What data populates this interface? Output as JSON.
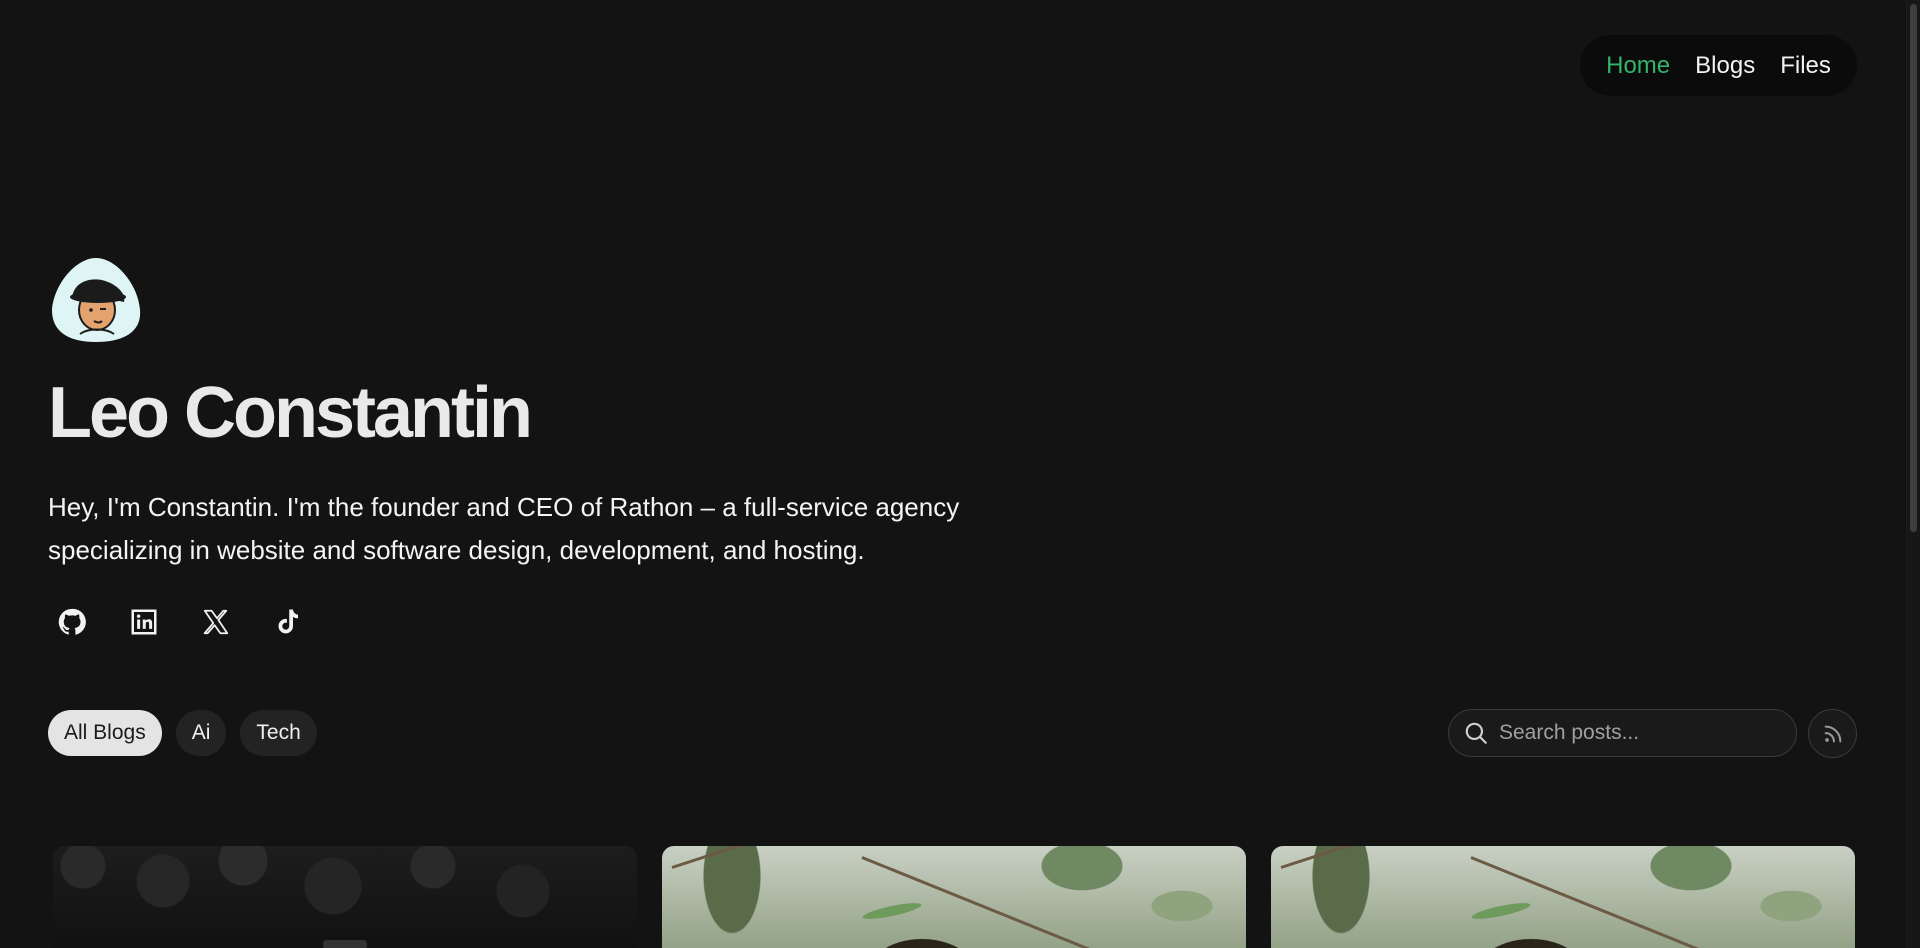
{
  "nav": {
    "items": [
      {
        "label": "Home",
        "active": true
      },
      {
        "label": "Blogs",
        "active": false
      },
      {
        "label": "Files",
        "active": false
      }
    ],
    "active_color": "#34b36a"
  },
  "profile": {
    "name": "Leo Constantin",
    "bio": "Hey, I'm Constantin. I'm the founder and CEO of Rathon – a full-service agency specializing in website and software design, development, and hosting.",
    "avatar_icon": "avatar-illustration-icon"
  },
  "socials": [
    {
      "name": "github-icon"
    },
    {
      "name": "linkedin-icon"
    },
    {
      "name": "x-icon"
    },
    {
      "name": "tiktok-icon"
    }
  ],
  "filters": [
    {
      "label": "All Blogs",
      "active": true
    },
    {
      "label": "Ai",
      "active": false
    },
    {
      "label": "Tech",
      "active": false
    }
  ],
  "search": {
    "placeholder": "Search posts..."
  },
  "rss": {
    "icon": "rss-icon"
  },
  "cards": [
    {
      "image": "dark-spheres-image"
    },
    {
      "image": "hedgehog-branches-image"
    },
    {
      "image": "hedgehog-branches-image"
    }
  ]
}
